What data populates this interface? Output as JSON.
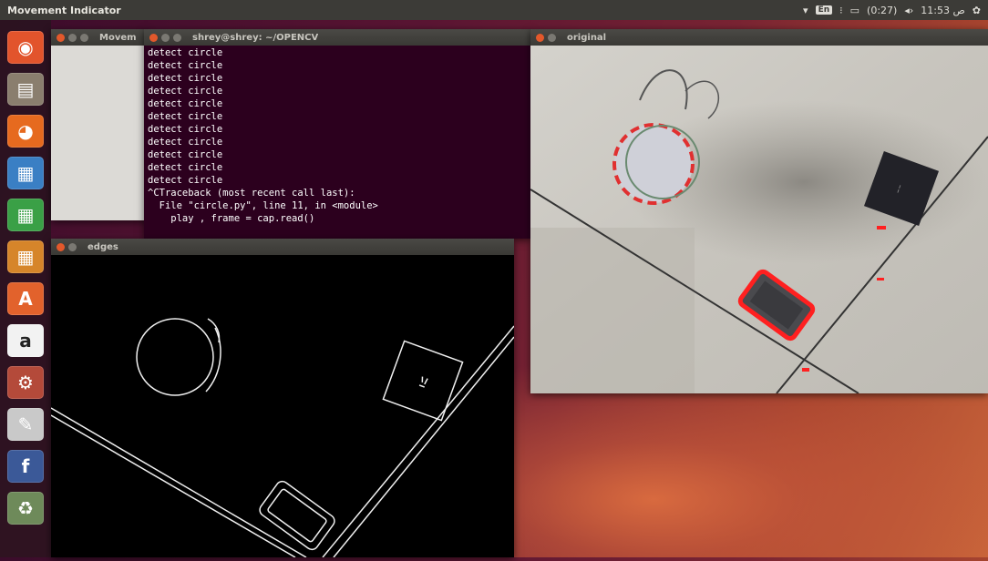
{
  "top_panel": {
    "title": "Movement Indicator",
    "keyboard_layout": "En",
    "battery": "(0:27)",
    "clock": "11:53 ص"
  },
  "launcher": {
    "items": [
      {
        "name": "ubuntu-dash-icon",
        "glyph": "◉",
        "color": "#e2542c"
      },
      {
        "name": "files-icon",
        "glyph": "▤",
        "color": "#8a7e6e"
      },
      {
        "name": "firefox-icon",
        "glyph": "◕",
        "color": "#e66a1f"
      },
      {
        "name": "writer-icon",
        "glyph": "▦",
        "color": "#3a7fc4"
      },
      {
        "name": "calc-icon",
        "glyph": "▦",
        "color": "#3aa046"
      },
      {
        "name": "impress-icon",
        "glyph": "▦",
        "color": "#d6852a"
      },
      {
        "name": "software-center-icon",
        "glyph": "A",
        "color": "#e2622c"
      },
      {
        "name": "amazon-icon",
        "glyph": "a",
        "color": "#f2f2f2"
      },
      {
        "name": "settings-icon",
        "glyph": "⚙",
        "color": "#b44a3a"
      },
      {
        "name": "text-editor-icon",
        "glyph": "✎",
        "color": "#c9c9c9"
      },
      {
        "name": "facebook-icon",
        "glyph": "f",
        "color": "#3b5998"
      },
      {
        "name": "trash-icon",
        "glyph": "♻",
        "color": "#6e8a5a"
      }
    ]
  },
  "movement_window": {
    "title": "Movem"
  },
  "terminal_window": {
    "title": "shrey@shrey: ~/OPENCV",
    "lines": [
      "detect circle",
      "detect circle",
      "detect circle",
      "detect circle",
      "detect circle",
      "detect circle",
      "detect circle",
      "detect circle",
      "detect circle",
      "detect circle",
      "detect circle",
      "^CTraceback (most recent call last):",
      "  File \"circle.py\", line 11, in <module>",
      "    play , frame = cap.read()"
    ]
  },
  "edges_window": {
    "title": "edges"
  },
  "original_window": {
    "title": "original"
  }
}
